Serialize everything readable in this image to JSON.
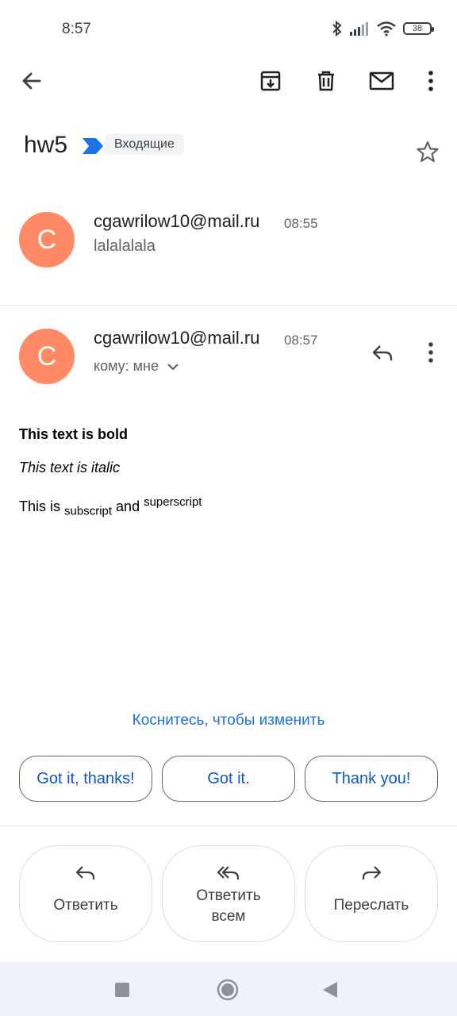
{
  "status_bar": {
    "time": "8:57",
    "battery": "38"
  },
  "email": {
    "subject": "hw5",
    "label": "Входящие",
    "messages": [
      {
        "avatar": "C",
        "sender": "cgawrilow10@mail.ru",
        "time": "08:55",
        "snippet": "lalalalala"
      },
      {
        "avatar": "C",
        "sender": "cgawrilow10@mail.ru",
        "time": "08:57",
        "to": "кому: мне"
      }
    ],
    "body": {
      "bold": "This text is bold",
      "italic": "This text is italic",
      "prefix": "This is ",
      "subscript": "subscript",
      "middle": " and ",
      "superscript": "superscript"
    }
  },
  "tap_to_edit": "Коснитесь, чтобы изменить",
  "smart_replies": [
    "Got it, thanks!",
    "Got it.",
    "Thank you!"
  ],
  "actions": {
    "reply": "Ответить",
    "reply_all_line1": "Ответить",
    "reply_all_line2": "всем",
    "forward": "Переслать"
  },
  "icons": {
    "back": "arrow-back-icon",
    "archive": "archive-icon",
    "delete": "delete-icon",
    "mark_unread": "mail-icon",
    "more": "more-vert-icon",
    "star": "star-icon",
    "reply": "reply-icon",
    "reply_all": "reply-all-icon",
    "forward": "forward-icon"
  },
  "colors": {
    "avatar": "#ff8a65",
    "accent": "#1a73e8",
    "label_arrow": "#1a73e8"
  }
}
